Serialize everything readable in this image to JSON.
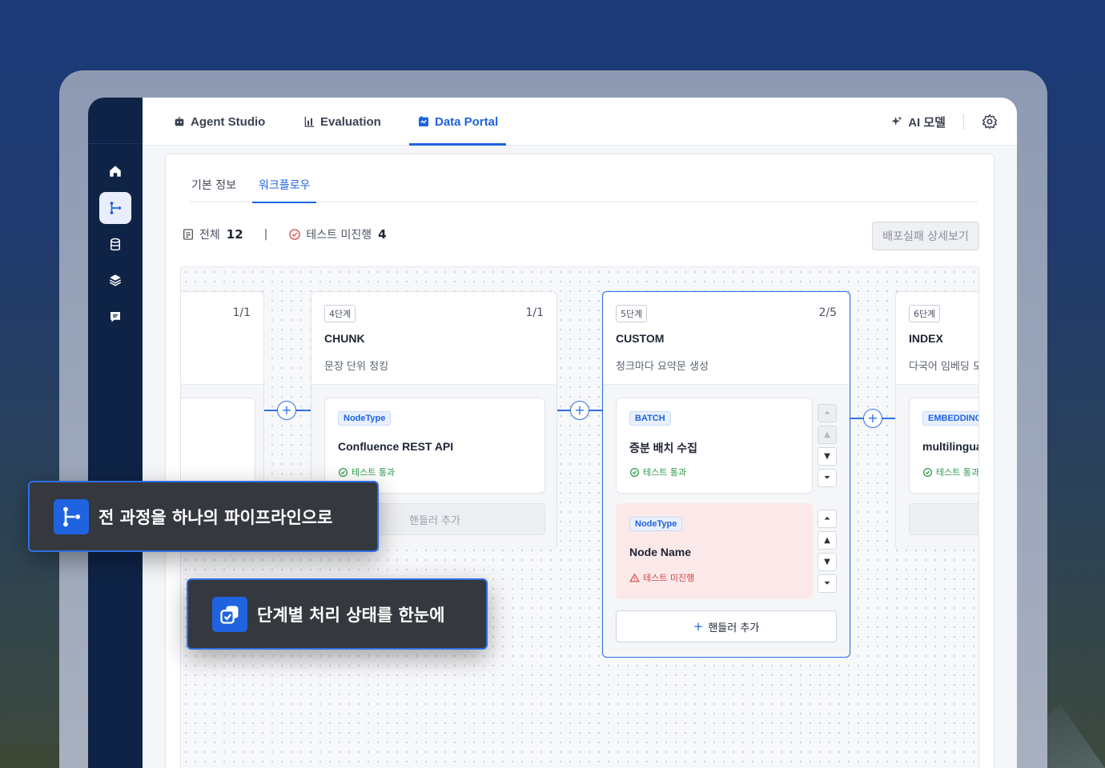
{
  "nav": {
    "tabs": [
      {
        "label": "Agent Studio",
        "icon": "robot-icon"
      },
      {
        "label": "Evaluation",
        "icon": "bar-chart-icon"
      },
      {
        "label": "Data Portal",
        "icon": "data-portal-icon",
        "active": true
      }
    ],
    "ai_model_label": "AI 모델"
  },
  "sidebar": {
    "items": [
      {
        "icon": "home-icon"
      },
      {
        "icon": "workflow-icon",
        "active": true
      },
      {
        "icon": "database-icon"
      },
      {
        "icon": "layers-icon"
      },
      {
        "icon": "chat-icon"
      }
    ]
  },
  "subtabs": [
    "기본 정보",
    "워크플로우"
  ],
  "stats": {
    "total_label": "전체",
    "total_value": "12",
    "untested_label": "테스트 미진행",
    "untested_value": "4",
    "separator": "|"
  },
  "deploy_fail_button": "배포실패 상세보기",
  "stages": [
    {
      "step": "",
      "count": "1/1",
      "title": "",
      "desc": ""
    },
    {
      "step": "4단계",
      "count": "1/1",
      "title": "CHUNK",
      "desc": "문장 단위 청킹",
      "nodes": [
        {
          "type": "NodeType",
          "name": "Confluence REST API",
          "status": "테스트 통과"
        }
      ],
      "handler": "핸들러 추가"
    },
    {
      "step": "5단계",
      "count": "2/5",
      "title": "CUSTOM",
      "desc": "청크마다 요약문 생성",
      "nodes": [
        {
          "type": "BATCH",
          "name": "증분 배치 수집",
          "status": "테스트 통과"
        },
        {
          "type": "NodeType",
          "name": "Node Name",
          "status": "테스트 미진행"
        }
      ],
      "handler": "핸들러 추가"
    },
    {
      "step": "6단계",
      "count": "",
      "title": "INDEX",
      "desc": "다국어 임베딩 모",
      "nodes": [
        {
          "type": "EMBEDDING",
          "name": "multilingual",
          "status": "테스트 통과"
        }
      ]
    }
  ],
  "callouts": [
    {
      "text": "전 과정을 하나의 파이프라인으로",
      "icon": "workflow-icon"
    },
    {
      "text": "단계별 처리 상태를 한눈에",
      "icon": "status-check-icon"
    }
  ],
  "colors": {
    "accent": "#1f63e0",
    "sidebar": "#0f2346",
    "pass": "#2d9a4b",
    "fail": "#d64545",
    "fail_bg": "#fbe9e9"
  }
}
